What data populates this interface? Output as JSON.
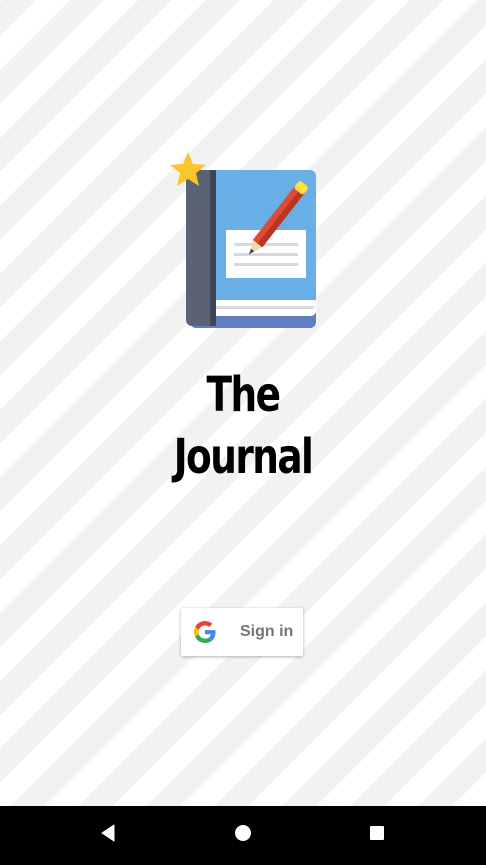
{
  "app": {
    "title_line1": "The",
    "title_line2": "Journal"
  },
  "signin": {
    "label": "Sign in",
    "provider_icon": "google-g-icon"
  },
  "logo": {
    "icon": "journal-book-with-pencil-and-star-icon",
    "colors": {
      "cover": "#6aaee6",
      "spine": "#5b6275",
      "pencil": "#e04a35",
      "pencil_tip": "#ffe03c",
      "star": "#fcc52c"
    }
  },
  "navbar": {
    "back_icon": "back-triangle-icon",
    "home_icon": "home-circle-icon",
    "recents_icon": "recents-square-icon"
  },
  "colors": {
    "background": "#ffffff",
    "stripe": "#f2f2f2",
    "navbar": "#000000",
    "signin_text": "#757575"
  }
}
